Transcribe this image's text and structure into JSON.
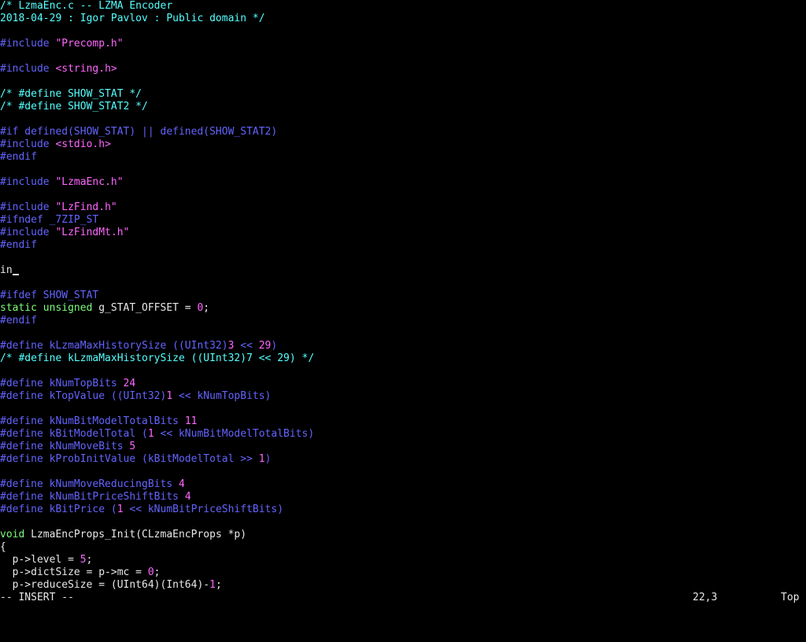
{
  "colors": {
    "background": "#000000",
    "comment": "#55ffff",
    "preprocessor": "#6464ff",
    "string": "#ff66ff",
    "number": "#ff66ff",
    "type": "#7cfc7c",
    "plain": "#e8e8e8"
  },
  "editor": {
    "lines": [
      [
        [
          "comment",
          "/* LzmaEnc.c -- LZMA Encoder"
        ]
      ],
      [
        [
          "comment",
          "2018-04-29 : Igor Pavlov : Public domain */"
        ]
      ],
      [],
      [
        [
          "pre",
          "#include "
        ],
        [
          "str",
          "\"Precomp.h\""
        ]
      ],
      [],
      [
        [
          "pre",
          "#include "
        ],
        [
          "str",
          "<string.h>"
        ]
      ],
      [],
      [
        [
          "comment",
          "/* #define SHOW_STAT */"
        ]
      ],
      [
        [
          "comment",
          "/* #define SHOW_STAT2 */"
        ]
      ],
      [],
      [
        [
          "pre",
          "#if defined(SHOW_STAT) || defined(SHOW_STAT2)"
        ]
      ],
      [
        [
          "pre",
          "#include "
        ],
        [
          "str",
          "<stdio.h>"
        ]
      ],
      [
        [
          "pre",
          "#endif"
        ]
      ],
      [],
      [
        [
          "pre",
          "#include "
        ],
        [
          "str",
          "\"LzmaEnc.h\""
        ]
      ],
      [],
      [
        [
          "pre",
          "#include "
        ],
        [
          "str",
          "\"LzFind.h\""
        ]
      ],
      [
        [
          "pre",
          "#ifndef _7ZIP_ST"
        ]
      ],
      [
        [
          "pre",
          "#include "
        ],
        [
          "str",
          "\"LzFindMt.h\""
        ]
      ],
      [
        [
          "pre",
          "#endif"
        ]
      ],
      [],
      [
        [
          "plain",
          "in"
        ],
        [
          "cursor",
          ""
        ]
      ],
      [],
      [
        [
          "pre",
          "#ifdef SHOW_STAT"
        ]
      ],
      [
        [
          "type",
          "static unsigned"
        ],
        [
          "plain",
          " g_STAT_OFFSET = "
        ],
        [
          "num",
          "0"
        ],
        [
          "plain",
          ";"
        ]
      ],
      [
        [
          "pre",
          "#endif"
        ]
      ],
      [],
      [
        [
          "pre",
          "#define kLzmaMaxHistorySize ((UInt32)"
        ],
        [
          "num",
          "3"
        ],
        [
          "pre",
          " << "
        ],
        [
          "num",
          "29"
        ],
        [
          "pre",
          ")"
        ]
      ],
      [
        [
          "comment",
          "/* #define kLzmaMaxHistorySize ((UInt32)7 << 29) */"
        ]
      ],
      [],
      [
        [
          "pre",
          "#define kNumTopBits "
        ],
        [
          "num",
          "24"
        ]
      ],
      [
        [
          "pre",
          "#define kTopValue ((UInt32)"
        ],
        [
          "num",
          "1"
        ],
        [
          "pre",
          " << kNumTopBits)"
        ]
      ],
      [],
      [
        [
          "pre",
          "#define kNumBitModelTotalBits "
        ],
        [
          "num",
          "11"
        ]
      ],
      [
        [
          "pre",
          "#define kBitModelTotal ("
        ],
        [
          "num",
          "1"
        ],
        [
          "pre",
          " << kNumBitModelTotalBits)"
        ]
      ],
      [
        [
          "pre",
          "#define kNumMoveBits "
        ],
        [
          "num",
          "5"
        ]
      ],
      [
        [
          "pre",
          "#define kProbInitValue (kBitModelTotal >> "
        ],
        [
          "num",
          "1"
        ],
        [
          "pre",
          ")"
        ]
      ],
      [],
      [
        [
          "pre",
          "#define kNumMoveReducingBits "
        ],
        [
          "num",
          "4"
        ]
      ],
      [
        [
          "pre",
          "#define kNumBitPriceShiftBits "
        ],
        [
          "num",
          "4"
        ]
      ],
      [
        [
          "pre",
          "#define kBitPrice ("
        ],
        [
          "num",
          "1"
        ],
        [
          "pre",
          " << kNumBitPriceShiftBits)"
        ]
      ],
      [],
      [
        [
          "type",
          "void"
        ],
        [
          "plain",
          " LzmaEncProps_Init(CLzmaEncProps *p)"
        ]
      ],
      [
        [
          "plain",
          "{"
        ]
      ],
      [
        [
          "plain",
          "  p->level = "
        ],
        [
          "num",
          "5"
        ],
        [
          "plain",
          ";"
        ]
      ],
      [
        [
          "plain",
          "  p->dictSize = p->mc = "
        ],
        [
          "num",
          "0"
        ],
        [
          "plain",
          ";"
        ]
      ],
      [
        [
          "plain",
          "  p->reduceSize = (UInt64)(Int64)-"
        ],
        [
          "num",
          "1"
        ],
        [
          "plain",
          ";"
        ]
      ]
    ]
  },
  "statusline": {
    "mode": "-- INSERT --",
    "cursor_position": "22,3",
    "scroll_position": "Top"
  }
}
